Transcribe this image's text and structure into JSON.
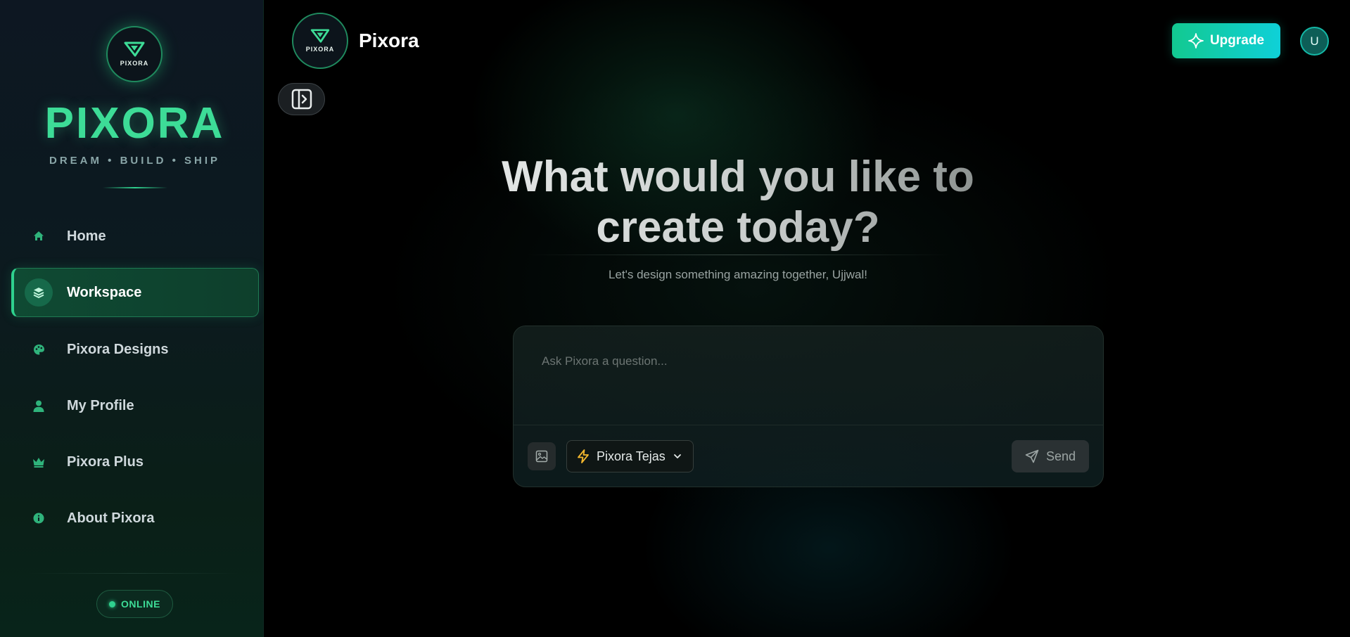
{
  "sidebar": {
    "brand": {
      "logo_text": "PIXORA",
      "name": "PIXORA",
      "tagline": "DREAM • BUILD • SHIP"
    },
    "items": [
      {
        "label": "Home",
        "icon": "home-icon"
      },
      {
        "label": "Workspace",
        "icon": "layers-icon",
        "active": true
      },
      {
        "label": "Pixora Designs",
        "icon": "palette-icon"
      },
      {
        "label": "My Profile",
        "icon": "user-icon"
      },
      {
        "label": "Pixora Plus",
        "icon": "crown-icon"
      },
      {
        "label": "About Pixora",
        "icon": "info-icon"
      }
    ],
    "status": "ONLINE"
  },
  "header": {
    "logo_text": "PIXORA",
    "title": "Pixora",
    "upgrade_label": "Upgrade",
    "avatar_initial": "U"
  },
  "hero": {
    "title": "What would you like to create today?",
    "subtitle": "Let's design something amazing together, Ujjwal!"
  },
  "prompt": {
    "placeholder": "Ask Pixora a question...",
    "model": "Pixora Tejas",
    "send_label": "Send"
  },
  "colors": {
    "accent": "#2fd18e",
    "brand_text": "#3ddc97",
    "upgrade_start": "#12c990",
    "upgrade_end": "#0fd0d8",
    "model_icon": "#f5b82e"
  }
}
